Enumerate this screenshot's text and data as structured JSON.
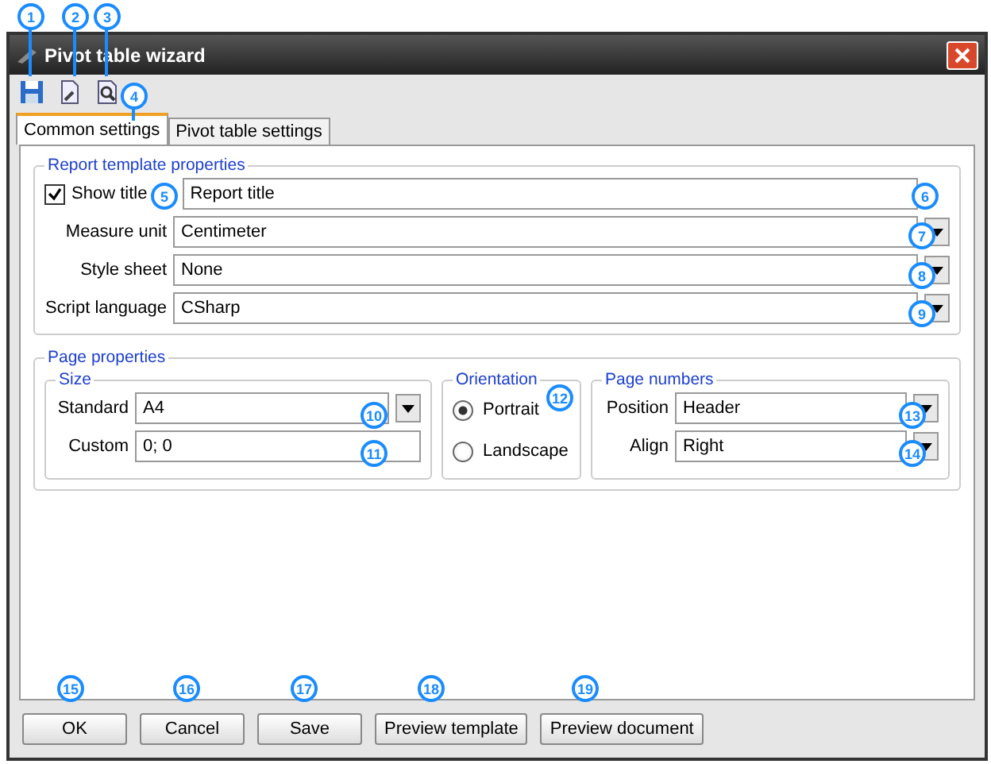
{
  "window": {
    "title": "Pivot table wizard"
  },
  "toolbar": [
    {
      "kind": "save"
    },
    {
      "kind": "template"
    },
    {
      "kind": "preview"
    }
  ],
  "tabs": [
    {
      "label": "Common settings",
      "selected": true
    },
    {
      "label": "Pivot table settings",
      "selected": false
    }
  ],
  "report_template": {
    "title": "Report template properties",
    "show_title": {
      "label": "Show title",
      "checked": true,
      "value": "Report title"
    },
    "rows": [
      {
        "label": "Measure unit",
        "value": "Centimeter"
      },
      {
        "label": "Style sheet",
        "value": "None"
      },
      {
        "label": "Script language",
        "value": "CSharp"
      }
    ]
  },
  "page_properties": {
    "title": "Page properties",
    "size": {
      "title": "Size",
      "rows": [
        {
          "label": "Standard",
          "value": "A4",
          "kind": "combo"
        },
        {
          "label": "Custom",
          "value": "0; 0",
          "kind": "text"
        }
      ]
    },
    "orientation": {
      "title": "Orientation",
      "options": [
        {
          "label": "Portrait",
          "selected": true
        },
        {
          "label": "Landscape",
          "selected": false
        }
      ]
    },
    "page_numbers": {
      "title": "Page numbers",
      "rows": [
        {
          "label": "Position",
          "value": "Header"
        },
        {
          "label": "Align",
          "value": "Right"
        }
      ]
    }
  },
  "buttons": [
    "OK",
    "Cancel",
    "Save",
    "Preview template",
    "Preview document"
  ],
  "callouts": [
    {
      "number": "1",
      "leader": true
    },
    {
      "number": "2",
      "leader": true
    },
    {
      "number": "3",
      "leader": true
    },
    {
      "number": "4",
      "leader": true
    },
    {
      "number": "5",
      "leader": false
    },
    {
      "number": "6",
      "leader": false
    },
    {
      "number": "7",
      "leader": false
    },
    {
      "number": "8",
      "leader": false
    },
    {
      "number": "9",
      "leader": false
    },
    {
      "number": "10",
      "leader": false
    },
    {
      "number": "11",
      "leader": false
    },
    {
      "number": "12",
      "leader": false
    },
    {
      "number": "13",
      "leader": false
    },
    {
      "number": "14",
      "leader": false
    },
    {
      "number": "15",
      "leader": false
    },
    {
      "number": "16",
      "leader": false
    },
    {
      "number": "17",
      "leader": false
    },
    {
      "number": "18",
      "leader": false
    },
    {
      "number": "19",
      "leader": false
    }
  ]
}
